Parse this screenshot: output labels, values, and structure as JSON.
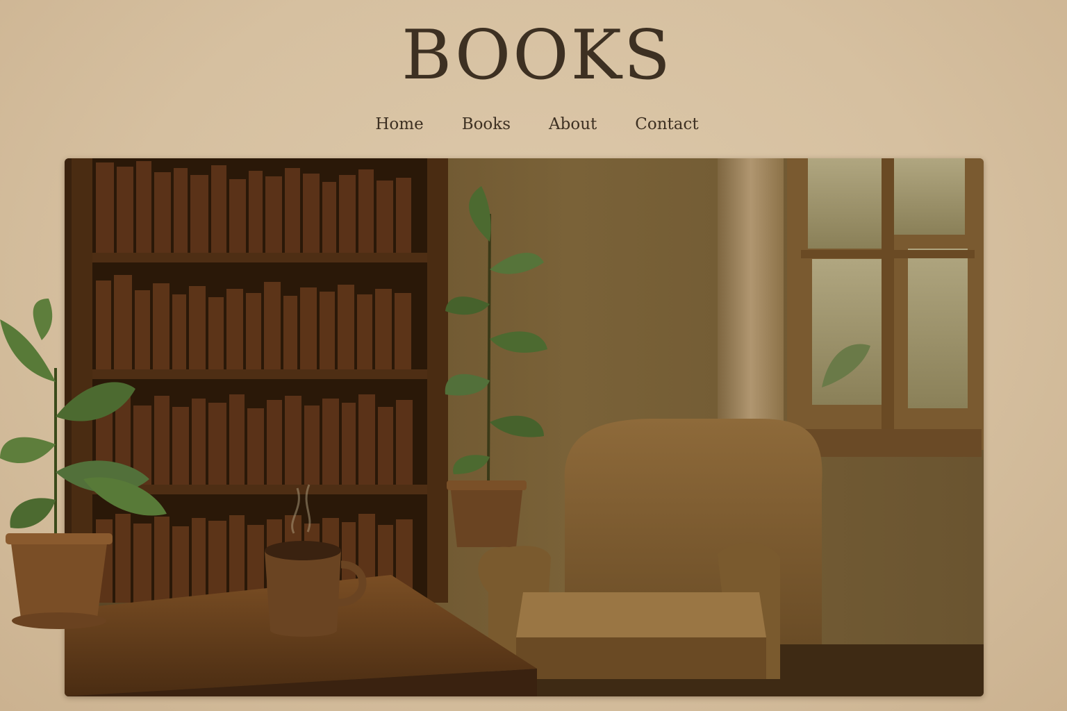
{
  "site": {
    "title": "BOOKS"
  },
  "nav": {
    "items": [
      {
        "label": "Home"
      },
      {
        "label": "Books"
      },
      {
        "label": "About"
      },
      {
        "label": "Contact"
      }
    ]
  },
  "hero": {
    "scene_elements": [
      "bookshelf",
      "potted-plant",
      "coffee-mug",
      "wooden-table",
      "armchair",
      "window",
      "curtain"
    ]
  },
  "colors": {
    "page_background": "#d6c0a0",
    "text": "#3d3022",
    "wall": "#6e5530",
    "wood": "#5a3a1c",
    "armchair": "#8a6638",
    "foliage": "#4c6a30"
  }
}
